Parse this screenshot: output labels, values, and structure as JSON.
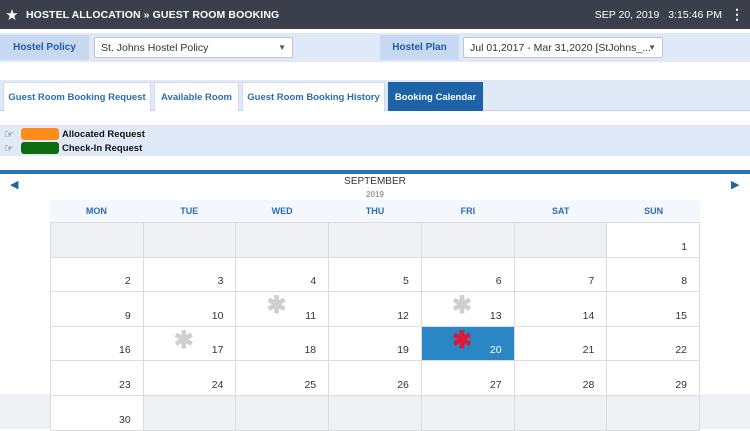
{
  "header": {
    "breadcrumb": "HOSTEL ALLOCATION » GUEST ROOM BOOKING",
    "date": "SEP 20, 2019",
    "time": "3:15:46 PM",
    "star_icon": "star-icon",
    "menu_icon": "more-vertical-icon"
  },
  "filters": {
    "hostel_policy_label": "Hostel Policy",
    "hostel_policy_value": "St. Johns Hostel Policy",
    "hostel_plan_label": "Hostel Plan",
    "hostel_plan_value": "Jul 01,2017 - Mar 31,2020 [StJohns_..."
  },
  "tabs": [
    {
      "label": "Guest Room Booking Request",
      "active": false
    },
    {
      "label": "Available Room",
      "active": false
    },
    {
      "label": "Guest Room Booking History",
      "active": false
    },
    {
      "label": "Booking Calendar",
      "active": true
    }
  ],
  "legend": [
    {
      "label": "Allocated Request",
      "color": "#ff8c1a"
    },
    {
      "label": "Check-In Request",
      "color": "#0f6b0f"
    }
  ],
  "calendar": {
    "month": "SEPTEMBER",
    "year": "2019",
    "days_of_week": [
      "MON",
      "TUE",
      "WED",
      "THU",
      "FRI",
      "SAT",
      "SUN"
    ],
    "weeks": [
      [
        "",
        "",
        "",
        "",
        "",
        "",
        "1"
      ],
      [
        "2",
        "3",
        "4",
        "5",
        "6",
        "7",
        "8"
      ],
      [
        "9",
        "10",
        "11",
        "12",
        "13",
        "14",
        "15"
      ],
      [
        "16",
        "17",
        "18",
        "19",
        "20",
        "21",
        "22"
      ],
      [
        "23",
        "24",
        "25",
        "26",
        "27",
        "28",
        "29"
      ],
      [
        "30",
        "",
        "",
        "",
        "",
        "",
        ""
      ]
    ],
    "today": "20",
    "marked_days": [
      "11",
      "13",
      "17",
      "20"
    ],
    "today_highlight_color": "#2b86c6",
    "today_mark_color": "#d81b3d"
  }
}
